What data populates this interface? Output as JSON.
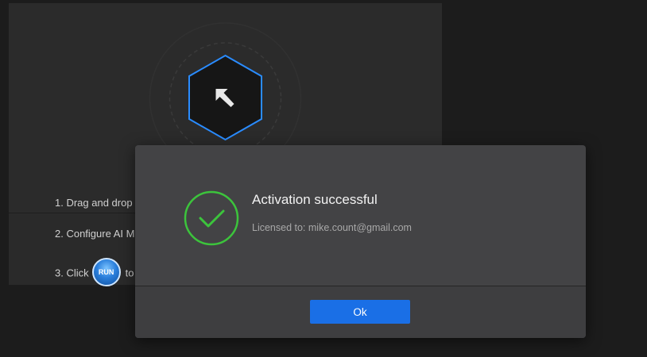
{
  "main": {
    "steps": {
      "step1": "1. Drag and drop",
      "step2": "2. Configure AI M",
      "step3_prefix": "3. Click",
      "step3_suffix": "to"
    },
    "run_badge": "RUN",
    "drop_icon": "upload-arrow-hexagon-icon"
  },
  "dialog": {
    "title": "Activation successful",
    "subtitle": "Licensed to: mike.count@gmail.com",
    "ok_label": "Ok",
    "icon": "checkmark-circle-icon"
  },
  "colors": {
    "background": "#1c1c1c",
    "panel": "#2a2a2a",
    "dialog": "#434345",
    "accent_blue": "#1a6fe6",
    "hex_outline": "#2a8cff",
    "success_green": "#3cc43c"
  }
}
